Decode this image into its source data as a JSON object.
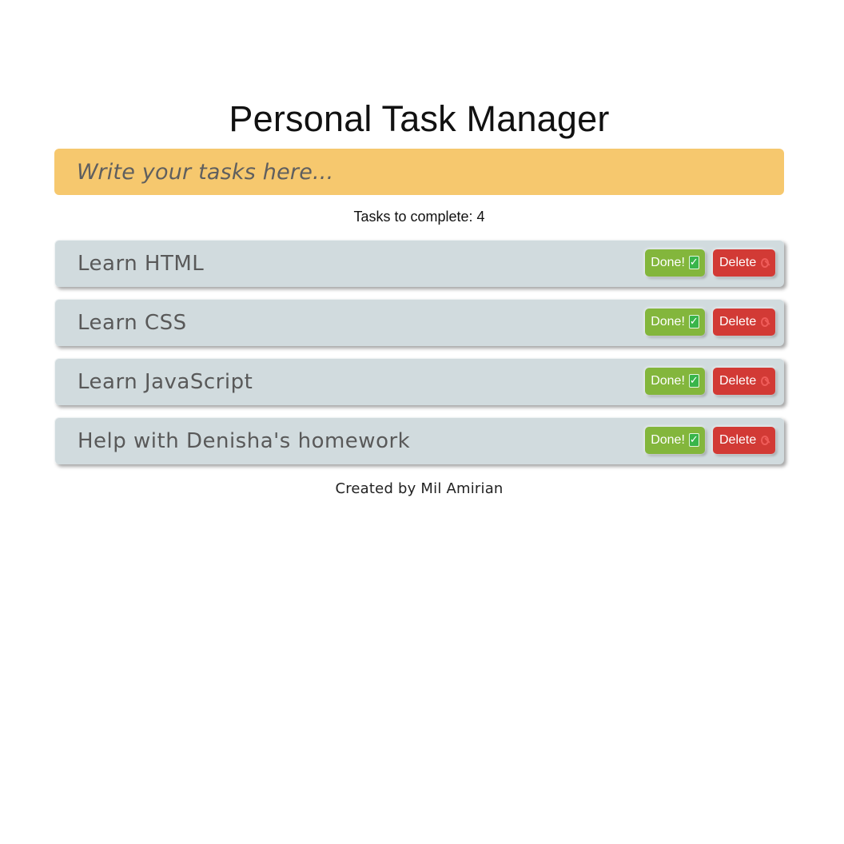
{
  "app": {
    "title": "Personal Task Manager"
  },
  "task_input": {
    "placeholder": "Write your tasks here...",
    "value": ""
  },
  "summary": {
    "label": "Tasks to complete: ",
    "count": "4"
  },
  "tasks": [
    {
      "text": "Learn HTML",
      "done_label": "Done!",
      "delete_label": "Delete"
    },
    {
      "text": "Learn CSS",
      "done_label": "Done!",
      "delete_label": "Delete"
    },
    {
      "text": "Learn JavaScript",
      "done_label": "Done!",
      "delete_label": "Delete"
    },
    {
      "text": "Help with Denisha's homework",
      "done_label": "Done!",
      "delete_label": "Delete"
    }
  ],
  "footer": {
    "text": "Created by Mil Amirian"
  },
  "icons": {
    "done": "check-box-icon",
    "delete": "no-entry-icon"
  },
  "colors": {
    "input_background": "#f6c86e",
    "task_background": "#d1dbde",
    "done_button": "#83b63c",
    "delete_button": "#d23a35"
  }
}
